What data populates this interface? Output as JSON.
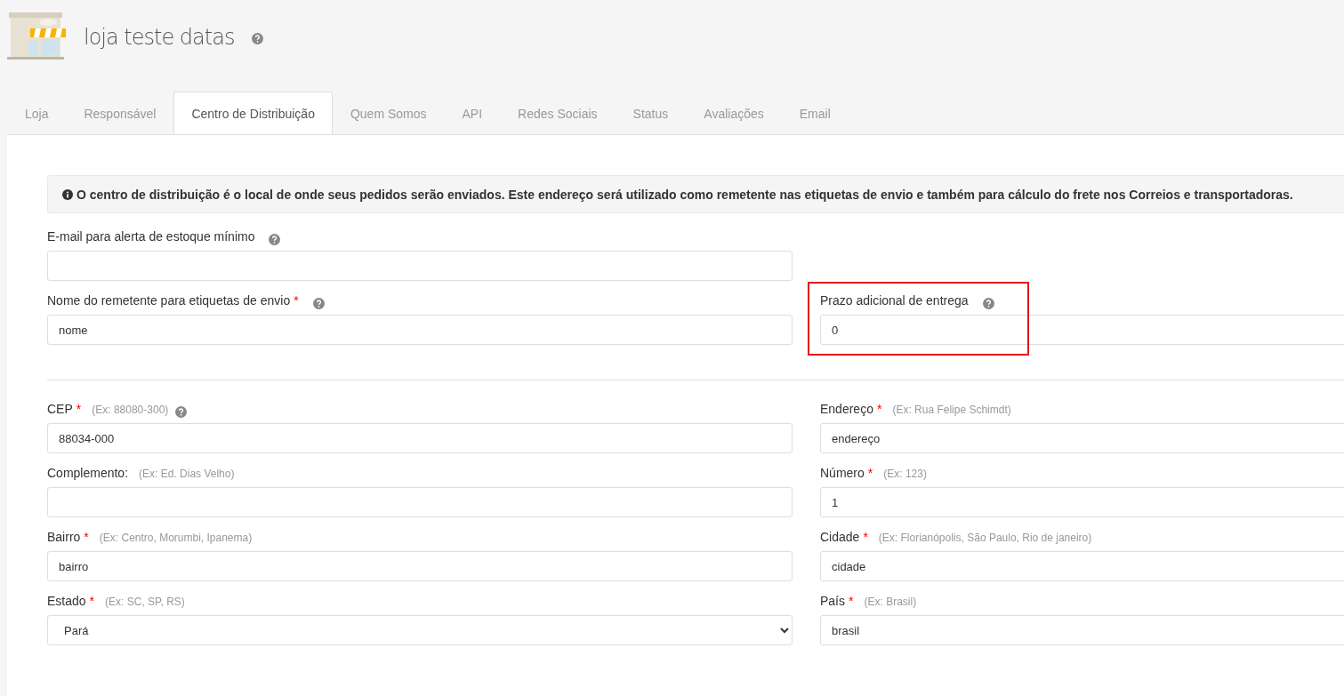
{
  "header": {
    "title": "loja teste datas"
  },
  "tabs": [
    {
      "label": "Loja",
      "selected": false
    },
    {
      "label": "Responsável",
      "selected": false
    },
    {
      "label": "Centro de Distribuição",
      "selected": true
    },
    {
      "label": "Quem Somos",
      "selected": false
    },
    {
      "label": "API",
      "selected": false
    },
    {
      "label": "Redes Sociais",
      "selected": false
    },
    {
      "label": "Status",
      "selected": false
    },
    {
      "label": "Avaliações",
      "selected": false
    },
    {
      "label": "Email",
      "selected": false
    }
  ],
  "alert": "O centro de distribuição é o local de onde seus pedidos serão enviados. Este endereço será utilizado como remetente nas etiquetas de envio e também para cálculo do frete nos Correios e transportadoras.",
  "top_rows": [
    [
      {
        "kind": "text",
        "label": "E-mail para alerta de estoque mínimo",
        "help": true
      }
    ],
    [
      {
        "kind": "text",
        "label": "Nome do remetente para etiquetas de envio",
        "required_mark": "*",
        "help": true,
        "value": "nome"
      },
      {
        "kind": "text",
        "label": "Prazo adicional de entrega",
        "help": true,
        "value": "0",
        "highlighted": true
      }
    ]
  ],
  "address_rows": [
    [
      {
        "kind": "text",
        "label": "CEP",
        "required_mark": "*",
        "hint": "(Ex: 88080-300)",
        "help": true,
        "value": "88034-000"
      },
      {
        "kind": "text",
        "label": "Endereço",
        "required_mark": "*",
        "hint": "(Ex: Rua Felipe Schimdt)",
        "help": false,
        "value": "endereço"
      }
    ],
    [
      {
        "kind": "text",
        "label": "Complemento:",
        "hint": "(Ex: Ed. Dias Velho)",
        "help": false
      },
      {
        "kind": "text",
        "label": "Número",
        "required_mark": "*",
        "hint": "(Ex: 123)",
        "help": false,
        "value": "1"
      }
    ],
    [
      {
        "kind": "text",
        "label": "Bairro",
        "required_mark": "*",
        "hint": "(Ex: Centro, Morumbi, Ipanema)",
        "help": false,
        "value": "bairro"
      },
      {
        "kind": "text",
        "label": "Cidade",
        "required_mark": "*",
        "hint": "(Ex: Florianópolis, São Paulo, Rio de janeiro)",
        "help": false,
        "value": "cidade"
      }
    ],
    [
      {
        "kind": "select",
        "label": "Estado",
        "required_mark": "*",
        "hint": "(Ex: SC, SP, RS)",
        "help": false,
        "value": "Pará"
      },
      {
        "kind": "text",
        "label": "País",
        "required_mark": "*",
        "hint": "(Ex: Brasil)",
        "help": false,
        "value": "brasil"
      }
    ]
  ]
}
